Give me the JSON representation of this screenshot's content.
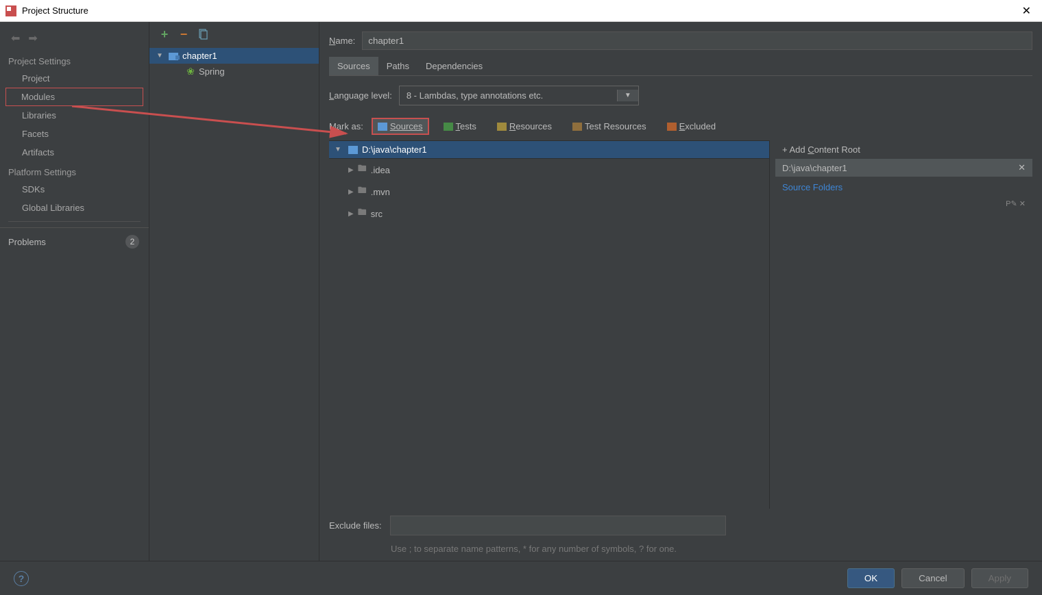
{
  "window": {
    "title": "Project Structure"
  },
  "sidebar": {
    "projectSettingsHeading": "Project Settings",
    "items": [
      "Project",
      "Modules",
      "Libraries",
      "Facets",
      "Artifacts"
    ],
    "platformSettingsHeading": "Platform Settings",
    "platformItems": [
      "SDKs",
      "Global Libraries"
    ],
    "problemsLabel": "Problems",
    "problemsCount": "2"
  },
  "moduleTree": {
    "root": "chapter1",
    "child": "Spring"
  },
  "name": {
    "label": "Name:",
    "value": "chapter1"
  },
  "tabs": [
    "Sources",
    "Paths",
    "Dependencies"
  ],
  "languageLevel": {
    "label": "Language level:",
    "value": "8 - Lambdas, type annotations etc."
  },
  "markAs": {
    "label": "Mark as:",
    "options": [
      "Sources",
      "Tests",
      "Resources",
      "Test Resources",
      "Excluded"
    ]
  },
  "dirTree": {
    "root": "D:\\java\\chapter1",
    "children": [
      ".idea",
      ".mvn",
      "src"
    ]
  },
  "contentRoots": {
    "addLabel": "Add Content Root",
    "path": "D:\\java\\chapter1",
    "sourceFoldersLabel": "Source Folders"
  },
  "exclude": {
    "label": "Exclude files:",
    "hint": "Use ; to separate name patterns, * for any number of symbols, ? for one."
  },
  "footer": {
    "ok": "OK",
    "cancel": "Cancel",
    "apply": "Apply"
  }
}
